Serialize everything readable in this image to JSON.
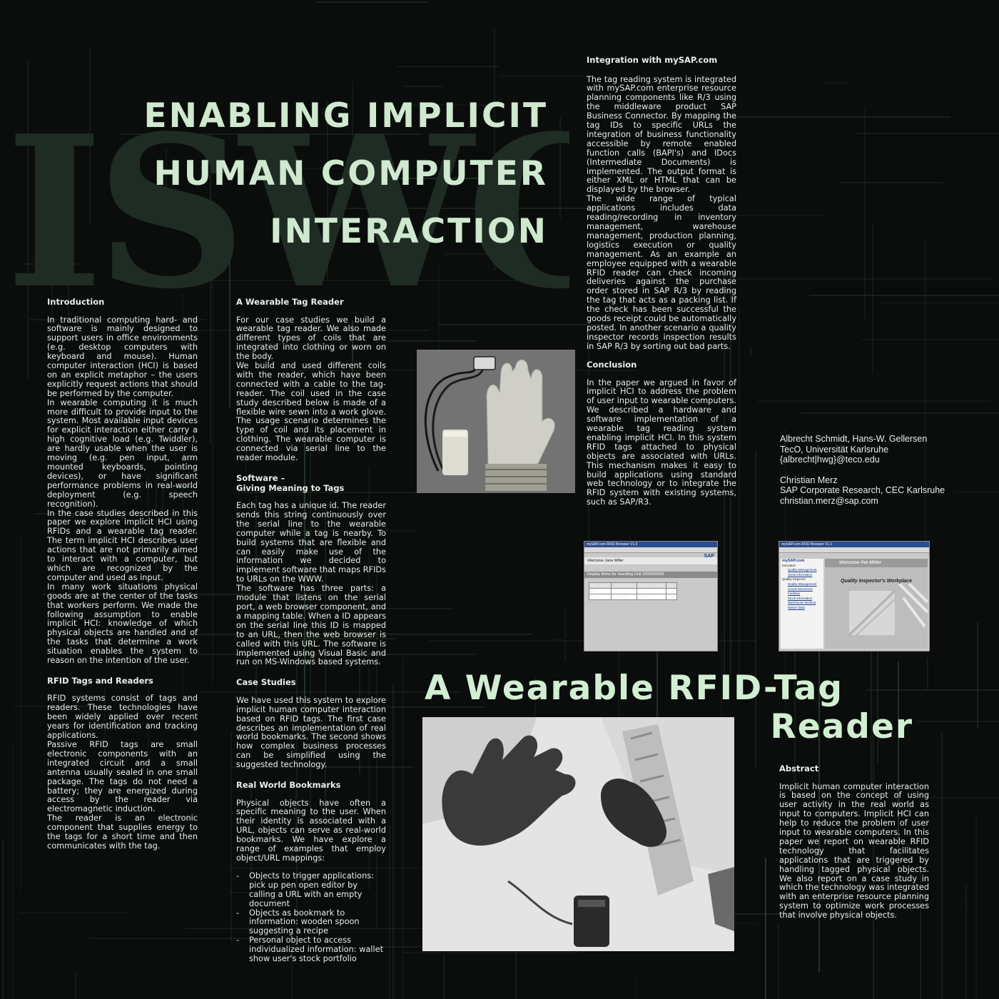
{
  "watermark": "ISWC",
  "title": {
    "line1": "ENABLING IMPLICIT",
    "line2": "HUMAN COMPUTER",
    "line3": "INTERACTION"
  },
  "subtitle": {
    "line1": "A Wearable RFID-Tag",
    "line2": "Reader"
  },
  "columns": {
    "col1": {
      "intro_heading": "Introduction",
      "intro_p1": "In traditional computing hard- and software is mainly designed to support users in office environments (e.g. desktop computers with keyboard and mouse). Human computer interaction (HCI) is based on an explicit metaphor – the users explicitly request actions that should be performed by the computer.",
      "intro_p2": "In wearable computing it is much more difficult to provide input to the system. Most available input devices for explicit interaction either carry a high cognitive load (e.g. Twiddler), are hardly usable when the user is moving (e.g. pen input, arm mounted keyboards, pointing devices), or have significant performance problems in real-world deployment (e.g. speech recognition).",
      "intro_p3": "In the case studies described in this paper we explore implicit HCI using RFIDs and a wearable tag reader. The term implicit HCI describes user actions that are not primarily aimed to interact with a computer, but which are recognized by the computer and used as input.",
      "intro_p4": "In many work situations physical goods are at the center of the tasks that workers perform. We made the following assumption to enable implicit HCI: knowledge of which physical objects are handled and of the tasks that determine a work situation enables the system to reason on the intention of the user.",
      "rfid_heading": "RFID Tags and Readers",
      "rfid_p1": "RFID systems consist of tags and readers. These technologies have been widely applied over recent years for identification and tracking applications.",
      "rfid_p2": "Passive RFID tags are small electronic components with an integrated circuit and a small antenna usually sealed in one small package. The tags do not need a battery; they are energized during access by the reader via electromagnetic induction.",
      "rfid_p3": "The reader is an electronic component that supplies energy to the tags for a short time and then communicates with the tag."
    },
    "col2": {
      "reader_heading": "A Wearable Tag Reader",
      "reader_p1": "For our case studies we build a wearable tag reader. We also made different types of coils that are integrated into clothing or worn on the body.",
      "reader_p2": "We build and used different coils with the reader, which have been connected with a cable to the tag-reader. The coil used in the case study described below is made of a flexible wire sewn into a work glove. The usage scenario determines the type of coil and its placement in clothing. The wearable computer is connected via serial line to the reader module.",
      "software_heading1": "Software –",
      "software_heading2": "Giving Meaning to Tags",
      "software_p1": "Each tag has a unique id. The reader sends this string continuously over the serial line to the wearable computer while a tag is nearby. To build systems that are flexible and can easily make use of the information we decided to implement software that maps RFIDs to URLs on the WWW.",
      "software_p2": "The software has three parts: a module that listens on the serial port, a web browser component, and a mapping table. When a ID appears on the serial line this ID is mapped to an URL, then the web browser is called with this URL. The software is implemented using Visual Basic and run on MS-Windows based systems.",
      "cases_heading": "Case Studies",
      "cases_p1": "We have used this system to explore implicit human computer interaction based on RFID tags. The first case describes an implementation of real world bookmarks. The second shows how complex business processes can be simplified using the suggested technology.",
      "bookmarks_heading": "Real World Bookmarks",
      "bookmarks_p1": "Physical objects have often a specific meaning to the user. When their identity is associated with a URL, objects can serve as real-world bookmarks. We have explore a range of examples that employ object/URL mappings:",
      "bullets": [
        "Objects to trigger applications: pick up pen open editor by calling a URL with an empty document",
        "Objects as bookmark to information: wooden spoon suggesting a recipe",
        "Personal object to access individualized information: wallet show user's stock portfolio"
      ]
    },
    "col3": {
      "sap_heading": "Integration with mySAP.com",
      "sap_p1": "The tag reading system is integrated with mySAP.com enterprise resource planning components like R/3 using the middleware product SAP Business Connector. By mapping the tag IDs to specific URLs the integration of business functionality accessible by remote enabled function calls (BAPI's) and IDocs (Intermediate Documents) is implemented. The output format is either XML or HTML that can be displayed by the browser.",
      "sap_p2": "The wide range of typical applications includes data reading/recording in inventory management, warehouse management, production planning, logistics execution or quality management. As an example an employee equipped with a wearable RFID reader can check incoming deliveries against the purchase order stored in SAP R/3 by reading the tag that acts as a packing list. If the check has been successful the goods receipt could be automatically posted. In another scenario a quality inspector records inspection results in SAP R/3 by sorting out bad parts.",
      "conclusion_heading": "Conclusion",
      "conclusion_p1": "In the paper we argued in favor of implicit HCI to address the problem of user input to wearable computers. We described a hardware and software implementation of a wearable tag reading system enabling implicit HCI. In this system RFID tags attached to physical objects are associated with URLs. This mechanism makes it easy to build applications using standard web technology or to integrate the RFID system with existing systems, such as SAP/R3."
    },
    "abstract": {
      "heading": "Abstract",
      "p1": "Implicit human computer interaction is based on the concept of using user activity in the real world as input to computers. Implicit HCI can help to reduce the problem of user input to wearable computers. In this paper we report on wearable RFID technology that facilitates applications that are triggered by handling tagged physical objects. We also report on a case study in which the technology was integrated with an enterprise resource planning system to optimize work processes that involve physical objects."
    }
  },
  "authors": {
    "a1_names": "Albrecht Schmidt, Hans-W. Gellersen",
    "a1_affil": "TecO, Universität Karlsruhe",
    "a1_email": "{albrecht|hwg}@teco.edu",
    "a2_name": "Christian Merz",
    "a2_affil": "SAP Corporate Research, CEC Karlsruhe",
    "a2_email": "christian.merz@sap.com"
  },
  "screenshot1": {
    "titlebar": "mySAP.com RFID Browser V1.0",
    "brand": "SAP",
    "welcome": "Welcome Jane Miller",
    "subheader": "Display Items for Handling Unit 2000000560",
    "headers": [
      "Material No.",
      "Description",
      "Packed Quantity",
      "Unit"
    ],
    "rows": [
      [
        "B4",
        "Intel Startup Kit",
        "10.000",
        "PCE"
      ],
      [
        "LB584",
        "Keyboard",
        "10.000",
        "PCE"
      ]
    ]
  },
  "screenshot2": {
    "titlebar": "mySAP.com RFID Browser V1.1",
    "brand": "mySAP.com",
    "welcome": "Welcome Pat Miller",
    "workplace": "Quality Inspector's Workplace",
    "menu": [
      "Executive",
      "Quality Management",
      "Stock Information",
      "Quality Inspector",
      "Quality Management",
      "Goods Movement",
      "Facilities",
      "Stock Information",
      "Warehouse Moment",
      "Master Data"
    ]
  },
  "colors": {
    "background": "#0a0d0b",
    "title": "#cfe8cf",
    "watermark": "#1f2c23",
    "text": "#e9efe9",
    "lines": "#36513e"
  }
}
